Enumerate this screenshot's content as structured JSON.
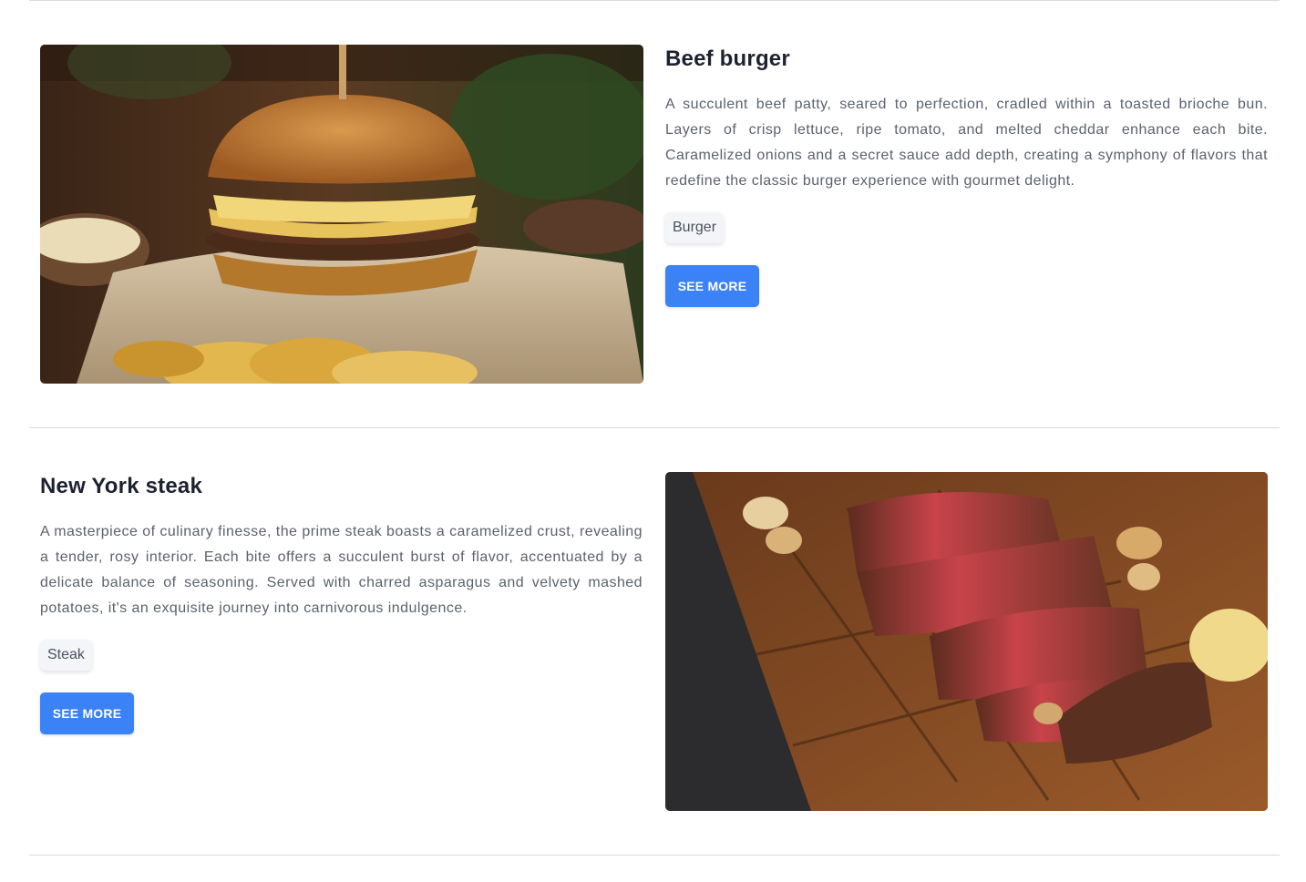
{
  "dishes": [
    {
      "title": "Beef burger",
      "description": "A succulent beef patty, seared to perfection, cradled within a toasted brioche bun. Layers of crisp lettuce, ripe tomato, and melted cheddar enhance each bite. Caramelized onions and a secret sauce add depth, creating a symphony of flavors that redefine the classic burger experience with gourmet delight.",
      "tag": "Burger",
      "button_label": "SEE MORE"
    },
    {
      "title": "New York steak",
      "description": "A masterpiece of culinary finesse, the prime steak boasts a caramelized crust, revealing a tender, rosy interior. Each bite offers a succulent burst of flavor, accentuated by a delicate balance of seasoning. Served with charred asparagus and velvety mashed potatoes, it's an exquisite journey into carnivorous indulgence.",
      "tag": "Steak",
      "button_label": "SEE MORE"
    }
  ],
  "colors": {
    "button": "#3b82f6",
    "divider": "#d9dce1",
    "title": "#1e2230",
    "body_text": "#5b616e"
  }
}
